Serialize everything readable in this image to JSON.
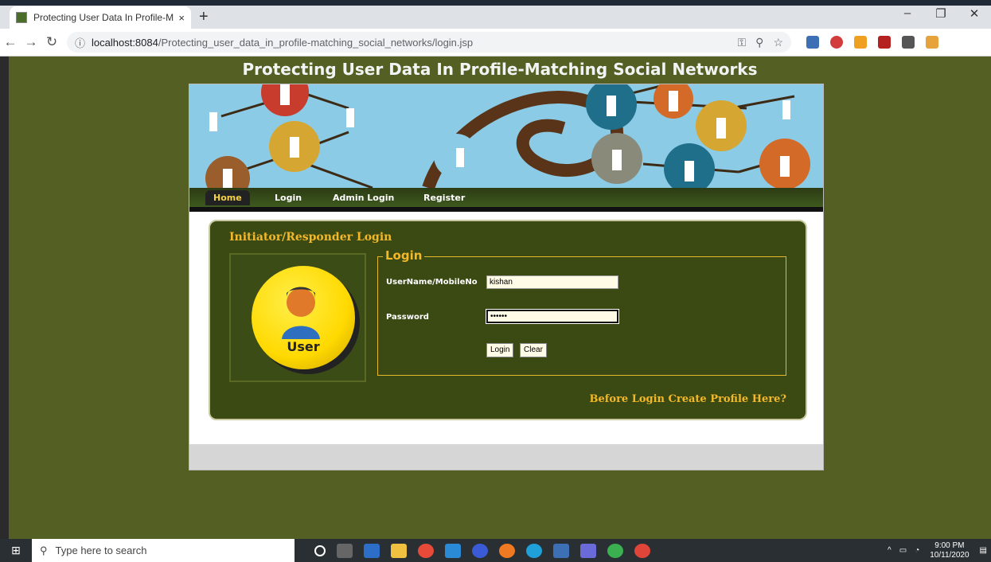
{
  "browser": {
    "tab_title": "Protecting User Data In Profile-M",
    "tab_close": "×",
    "new_tab": "+",
    "url_host": "localhost:8084",
    "url_path": "/Protecting_user_data_in_profile-matching_social_networks/login.jsp",
    "window_controls": [
      "–",
      "❐",
      "✕"
    ]
  },
  "page": {
    "site_title": "Protecting User Data In Profile-Matching Social Networks",
    "nav": [
      "Home",
      "Login",
      "Admin Login",
      "Register"
    ],
    "panel_heading": "Initiator/Responder Login",
    "avatar_label": "User",
    "legend": "Login",
    "username_label": "UserName/MobileNo",
    "username_value": "kishan",
    "password_label": "Password",
    "password_value": "••••••",
    "login_button": "Login",
    "clear_button": "Clear",
    "create_profile_link": "Before Login Create Profile Here?"
  },
  "taskbar": {
    "search_placeholder": "Type here to search",
    "time": "9:00 PM",
    "date": "10/11/2020"
  },
  "colors": {
    "page_bg": "#545f24",
    "panel_bg": "#3a4a12",
    "accent_gold": "#f3b82a"
  }
}
